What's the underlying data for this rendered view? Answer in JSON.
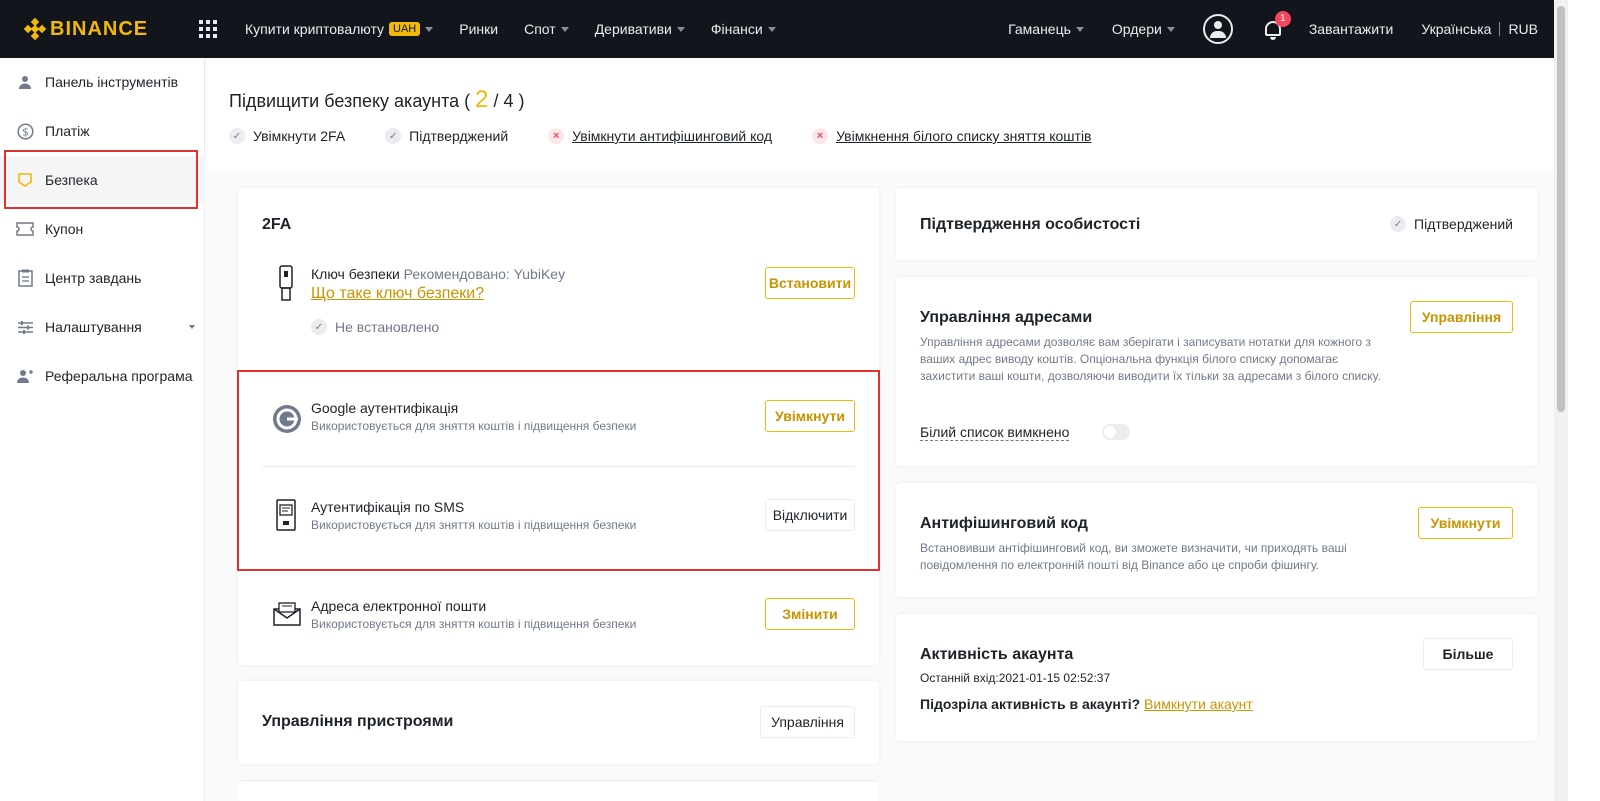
{
  "nav": {
    "brand": "BINANCE",
    "buy_crypto": "Купити криптовалюту",
    "currency_badge": "UAH",
    "markets": "Ринки",
    "spot": "Спот",
    "derivatives": "Деривативи",
    "finance": "Фінанси",
    "wallet": "Гаманець",
    "orders": "Ордери",
    "notification_count": "1",
    "download": "Завантажити",
    "language": "Українська",
    "fiat": "RUB"
  },
  "sidebar": {
    "items": [
      {
        "label": "Панель інструментів",
        "icon": "user-icon"
      },
      {
        "label": "Платіж",
        "icon": "dollar-icon"
      },
      {
        "label": "Безпека",
        "icon": "shield-icon"
      },
      {
        "label": "Купон",
        "icon": "ticket-icon"
      },
      {
        "label": "Центр завдань",
        "icon": "clipboard-icon"
      },
      {
        "label": "Налаштування",
        "icon": "sliders-icon"
      },
      {
        "label": "Реферальна програма",
        "icon": "user-add-icon"
      }
    ]
  },
  "security_header": {
    "title_prefix": "Підвищити безпеку акаунта (",
    "level_current": "2",
    "level_total": "/ 4 )",
    "checks": [
      {
        "label": "Увімкнути 2FA",
        "status": "ok"
      },
      {
        "label": "Підтверджений",
        "status": "ok"
      },
      {
        "label": "Увімкнути антифішинговий код",
        "status": "missing"
      },
      {
        "label": "Увімкнення білого списку зняття коштів",
        "status": "missing"
      }
    ]
  },
  "twofa": {
    "title": "2FA",
    "security_key": {
      "title": "Ключ безпеки",
      "recommended": "Рекомендовано: YubiKey",
      "link": "Що таке ключ безпеки?",
      "status": "Не встановлено",
      "button": "Встановити"
    },
    "google": {
      "title": "Google аутентифікація",
      "desc": "Використовується для зняття коштів і підвищення безпеки",
      "button": "Увімкнути"
    },
    "sms": {
      "title": "Аутентифікація по SMS",
      "desc": "Використовується для зняття коштів і підвищення безпеки",
      "button": "Відключити"
    },
    "email": {
      "title": "Адреса електронної пошти",
      "desc": "Використовується для зняття коштів і підвищення безпеки",
      "button": "Змінити"
    }
  },
  "devices": {
    "title": "Управління пристроями",
    "button": "Управління"
  },
  "identity": {
    "title": "Підтвердження особистості",
    "status": "Підтверджений"
  },
  "address_mgmt": {
    "title": "Управління адресами",
    "desc": "Управління адресами дозволяє вам зберігати і записувати нотатки для кожного з ваших адрес виводу коштів. Опціональна функція білого списку допомагає захистити ваші кошти, дозволяючи виводити їх тільки за адресами з білого списку.",
    "button": "Управління",
    "whitelist_label": "Білий список вимкнено"
  },
  "antiphishing": {
    "title": "Антифішинговий код",
    "desc": "Встановивши антіфішинговий код, ви зможете визначити, чи приходять ваші повідомлення по електронній пошті від Binance або це спроби фішингу.",
    "button": "Увімкнути"
  },
  "activity": {
    "title": "Активність акаунта",
    "last_login": "Останній вхід:2021-01-15 02:52:37",
    "suspicious": "Підозріла активність в акаунті?",
    "disable_link": "Вимкнути акаунт",
    "button": "Більше"
  },
  "colors": {
    "accent": "#f0b90b",
    "nav_bg": "#12161c",
    "highlight": "#e0312e"
  }
}
